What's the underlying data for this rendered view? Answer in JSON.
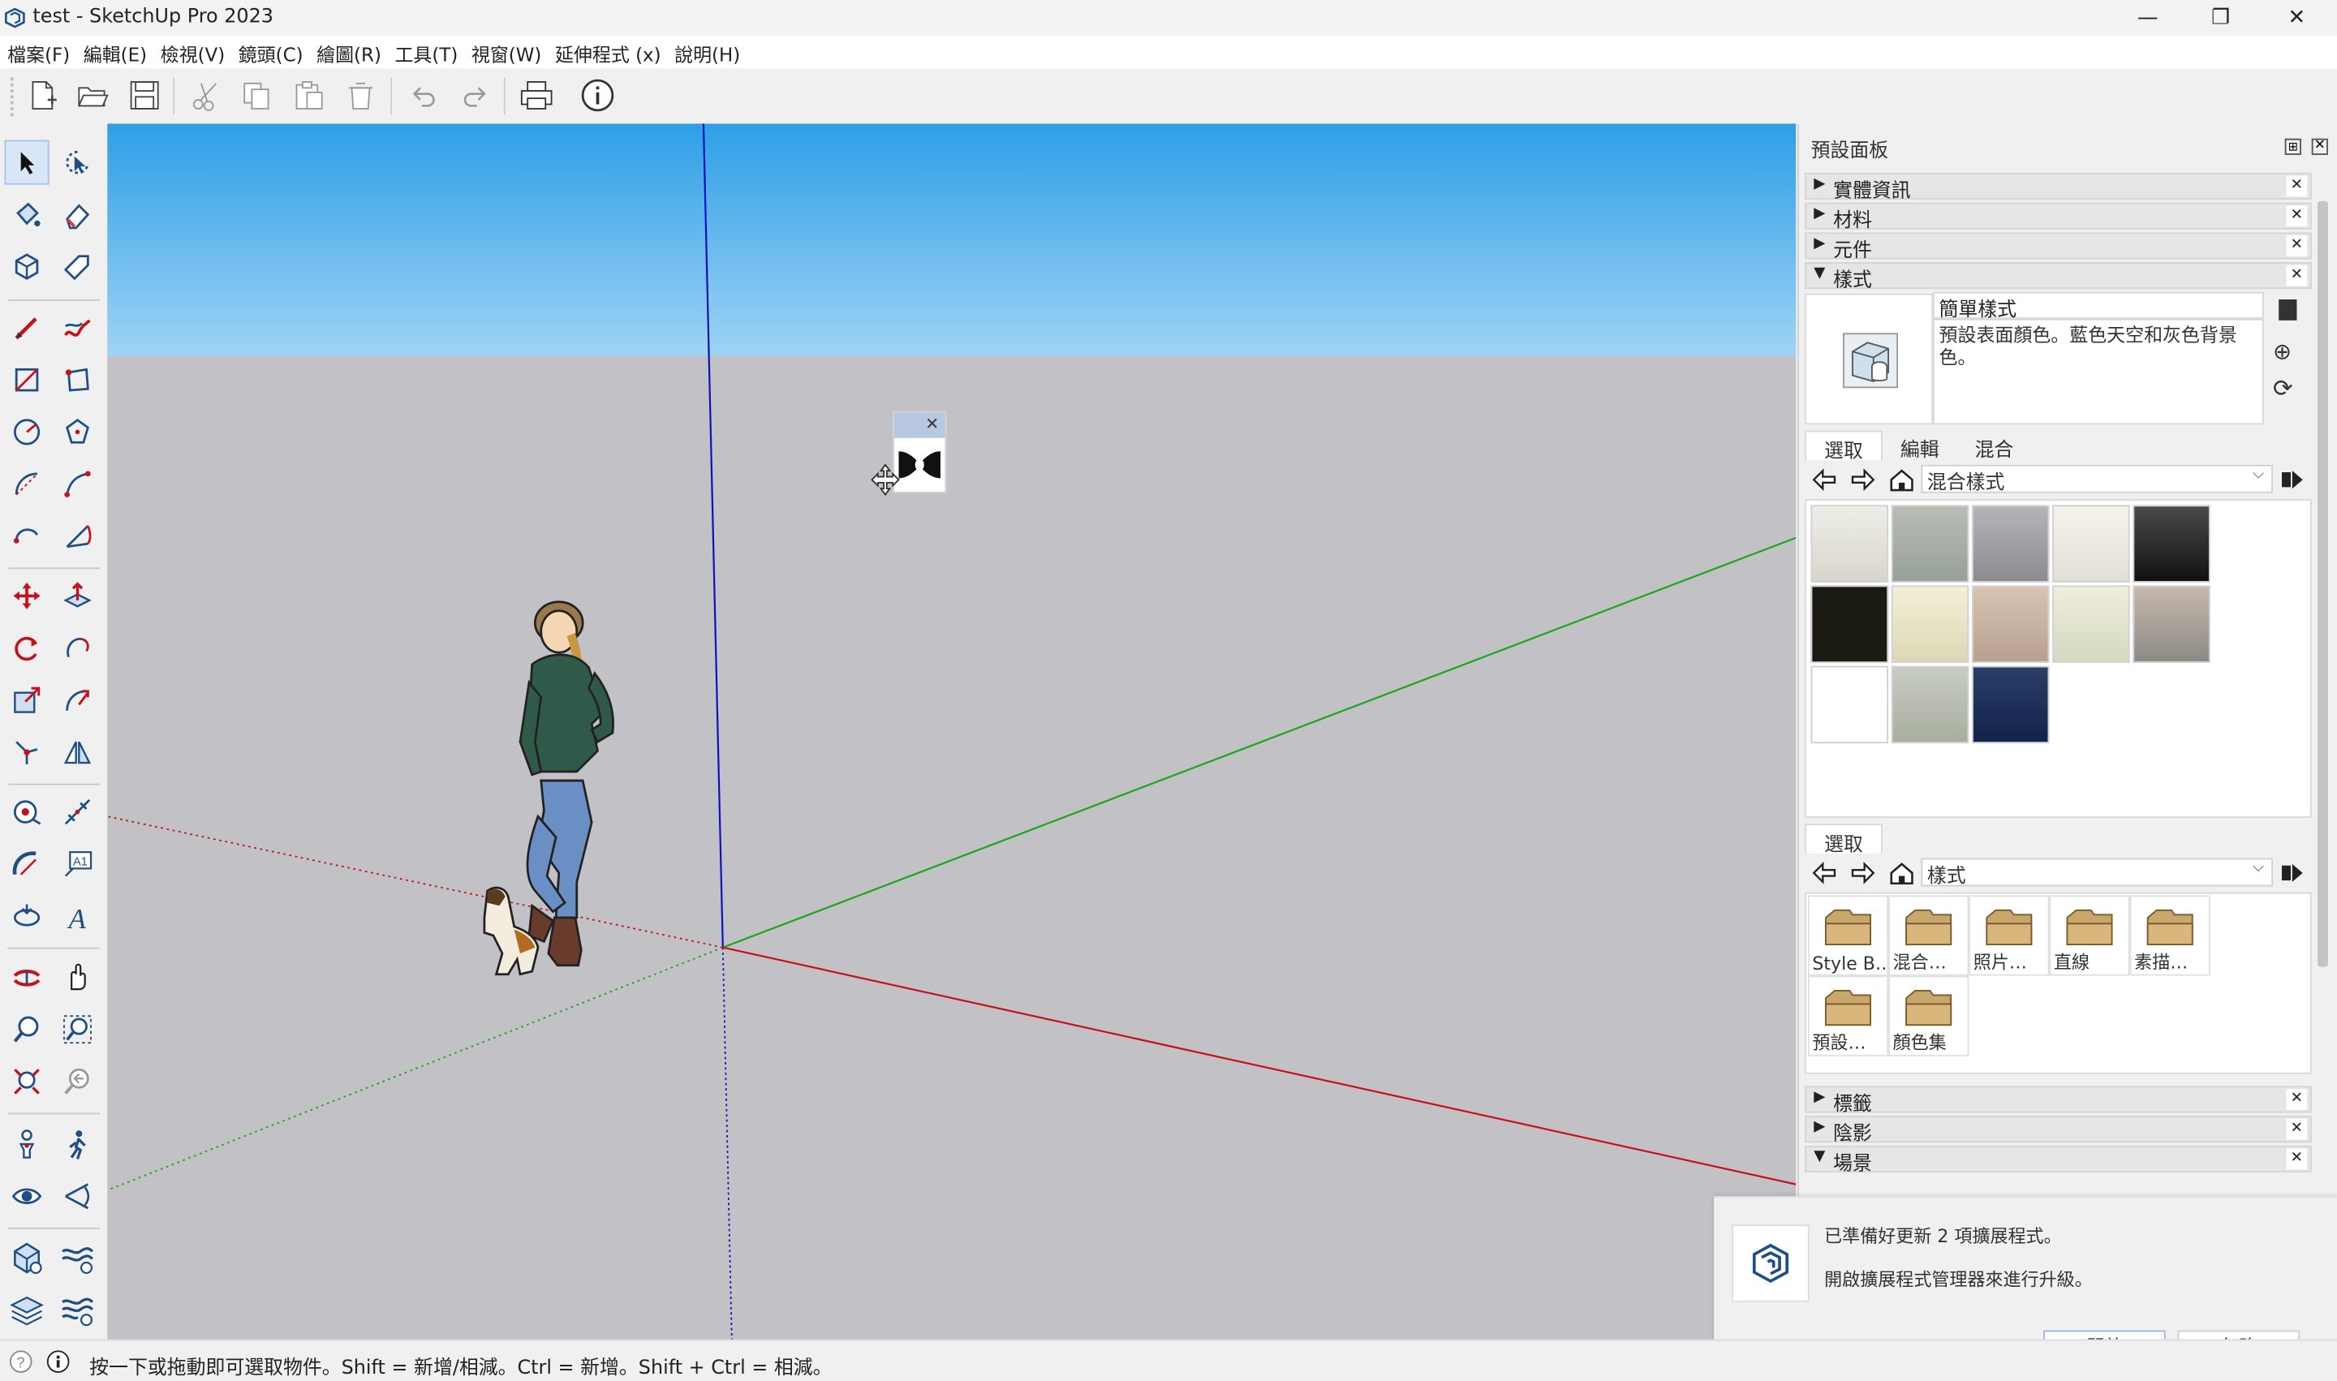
{
  "window": {
    "title": "test - SketchUp Pro 2023",
    "minimize": "—",
    "restore": "❐",
    "close": "✕"
  },
  "menu": [
    "檔案(F)",
    "編輯(E)",
    "檢視(V)",
    "鏡頭(C)",
    "繪圖(R)",
    "工具(T)",
    "視窗(W)",
    "延伸程式 (x)",
    "說明(H)"
  ],
  "tray": {
    "title": "預設面板",
    "panels_top": [
      {
        "label": "實體資訊",
        "expanded": false
      },
      {
        "label": "材料",
        "expanded": false
      },
      {
        "label": "元件",
        "expanded": false
      },
      {
        "label": "樣式",
        "expanded": true
      }
    ],
    "styles": {
      "name": "簡單樣式",
      "description": "預設表面顏色。藍色天空和灰色背景色。",
      "tabs": [
        "選取",
        "編輯",
        "混合"
      ],
      "active_tab": "選取",
      "collection": "混合樣式",
      "secondary_tab": "選取",
      "secondary_collection": "樣式",
      "folders": [
        "Style B…",
        "混合…",
        "照片…",
        "直線",
        "素描…",
        "預設…",
        "顏色集"
      ]
    },
    "panels_bottom": [
      {
        "label": "標籤",
        "expanded": false
      },
      {
        "label": "陰影",
        "expanded": false
      },
      {
        "label": "場景",
        "expanded": true
      }
    ]
  },
  "notification": {
    "line1": "已準備好更新 2 項擴展程式。",
    "line2": "開啟擴展程式管理器來進行升級。",
    "open_button": "開啟",
    "ignore_button": "忽略"
  },
  "status": {
    "text": "按一下或拖動即可選取物件。Shift = 新增/相減。Ctrl = 新增。Shift + Ctrl = 相減。"
  },
  "colors": {
    "sky_top": "#2e9fe6",
    "ground": "#c2c2c6",
    "axis_red": "#c8101a",
    "axis_green": "#1aa81a",
    "axis_blue": "#1010c0"
  }
}
